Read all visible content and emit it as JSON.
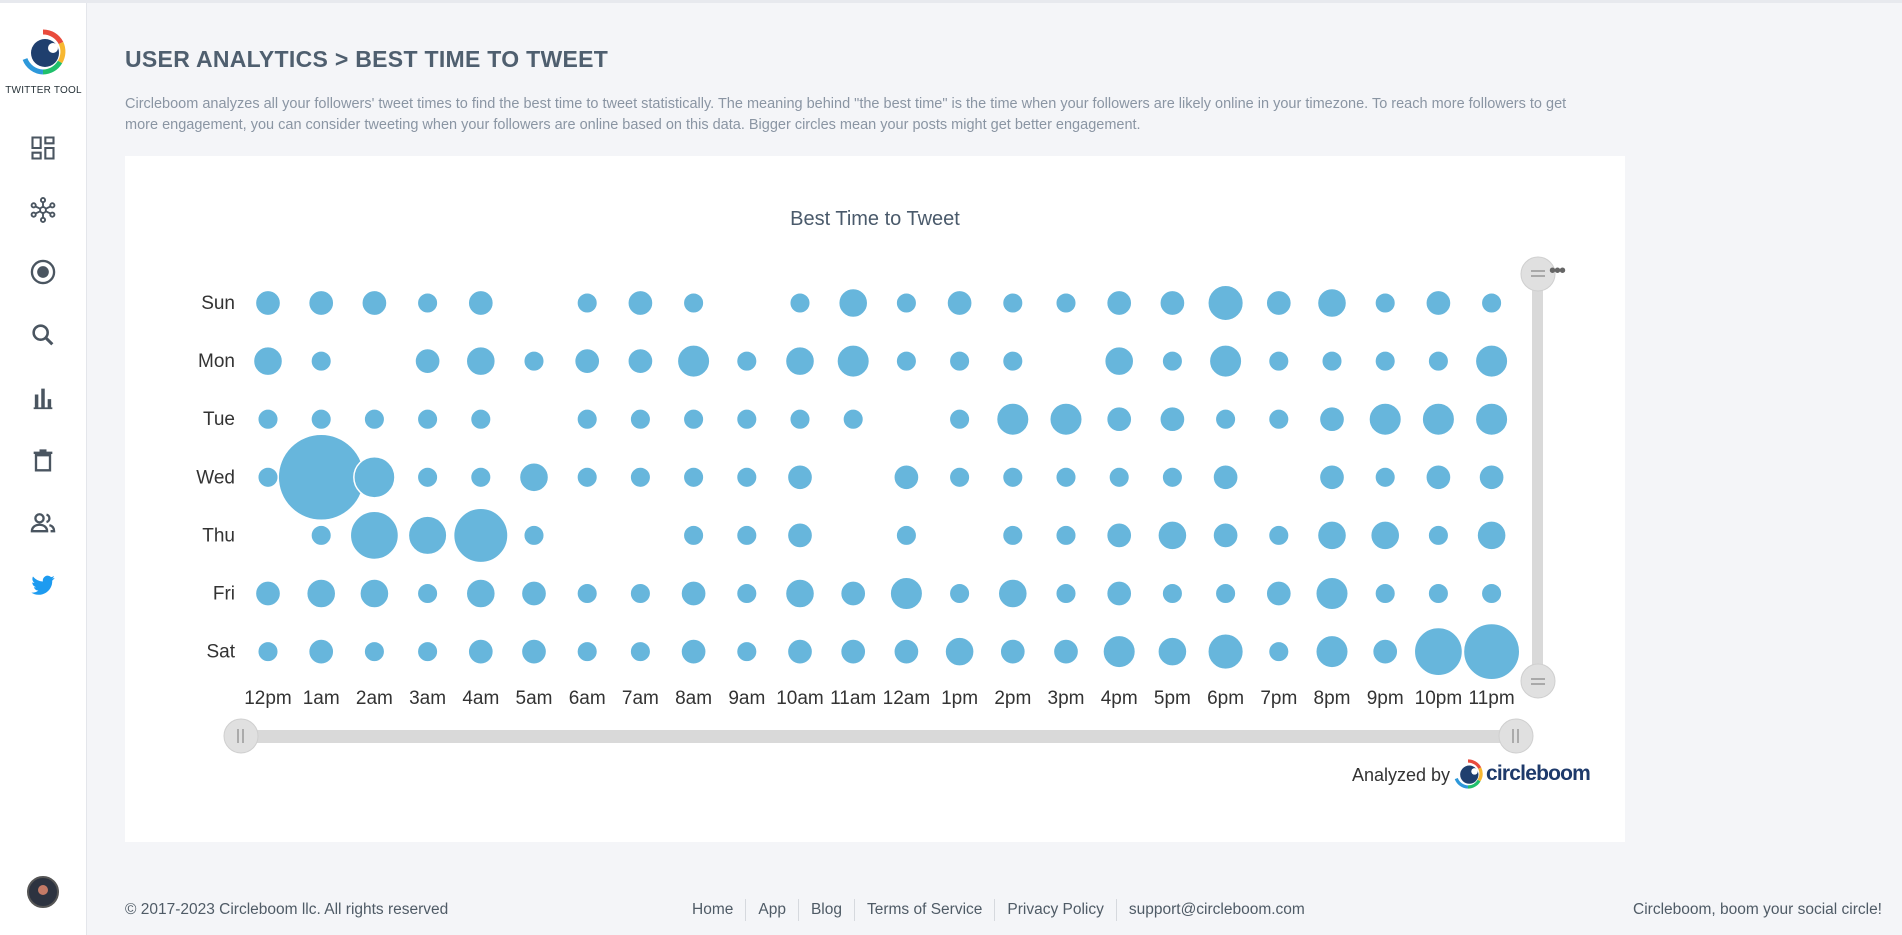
{
  "sidebar": {
    "logo_text": "TWITTER TOOL",
    "items": [
      {
        "name": "dashboard",
        "icon": "dashboard-icon"
      },
      {
        "name": "circle",
        "icon": "network-icon"
      },
      {
        "name": "target",
        "icon": "target-icon"
      },
      {
        "name": "search",
        "icon": "search-icon"
      },
      {
        "name": "analytics",
        "icon": "bar-chart-icon"
      },
      {
        "name": "delete",
        "icon": "trash-icon"
      },
      {
        "name": "users",
        "icon": "people-icon"
      },
      {
        "name": "twitter",
        "icon": "twitter-bird-icon"
      }
    ],
    "avatar": "avatar"
  },
  "header": {
    "title": "USER ANALYTICS > BEST TIME TO TWEET",
    "description": "Circleboom analyzes all your followers' tweet times to find the best time to tweet statistically. The meaning behind \"the best time\" is the time when your followers are likely online in your timezone. To reach more followers to get more engagement, you can consider tweeting when your followers are online based on this data. Bigger circles mean your posts might get better engagement."
  },
  "chart_data": {
    "type": "scatter",
    "title": "Best Time to Tweet",
    "x": [
      "12pm",
      "1am",
      "2am",
      "3am",
      "4am",
      "5am",
      "6am",
      "7am",
      "8am",
      "9am",
      "10am",
      "11am",
      "12am",
      "1pm",
      "2pm",
      "3pm",
      "4pm",
      "5pm",
      "6pm",
      "7pm",
      "8pm",
      "9pm",
      "10pm",
      "11pm"
    ],
    "y": [
      "Sun",
      "Mon",
      "Tue",
      "Wed",
      "Thu",
      "Fri",
      "Sat"
    ],
    "sizes": [
      [
        3,
        3,
        3,
        2,
        3,
        0,
        2,
        3,
        2,
        0,
        2,
        4,
        2,
        3,
        2,
        2,
        3,
        3,
        6,
        3,
        4,
        2,
        3,
        2
      ],
      [
        4,
        2,
        0,
        3,
        4,
        2,
        3,
        3,
        5,
        2,
        4,
        5,
        2,
        2,
        2,
        0,
        4,
        2,
        5,
        2,
        2,
        2,
        2,
        5
      ],
      [
        2,
        2,
        2,
        2,
        2,
        0,
        2,
        2,
        2,
        2,
        2,
        2,
        0,
        2,
        5,
        5,
        3,
        3,
        2,
        2,
        3,
        5,
        5,
        5
      ],
      [
        2,
        35,
        8,
        2,
        2,
        4,
        2,
        2,
        2,
        2,
        3,
        0,
        3,
        2,
        2,
        2,
        2,
        2,
        3,
        0,
        3,
        2,
        3,
        3
      ],
      [
        0,
        2,
        11,
        7,
        14,
        2,
        0,
        0,
        2,
        2,
        3,
        0,
        2,
        0,
        2,
        2,
        3,
        4,
        3,
        2,
        4,
        4,
        2,
        4
      ],
      [
        3,
        4,
        4,
        2,
        4,
        3,
        2,
        2,
        3,
        2,
        4,
        3,
        5,
        2,
        4,
        2,
        3,
        2,
        2,
        3,
        5,
        2,
        2,
        2
      ],
      [
        2,
        3,
        2,
        2,
        3,
        3,
        2,
        2,
        3,
        2,
        3,
        3,
        3,
        4,
        3,
        3,
        5,
        4,
        6,
        2,
        5,
        3,
        11,
        15
      ]
    ],
    "series": [
      {
        "name": "",
        "color": "#67b6dc"
      }
    ],
    "scroll_color": "#d9d9d9",
    "scroll_handle_color": "#e0e0e0",
    "legend": "none"
  },
  "card": {
    "analyzed_label": "Analyzed by",
    "brand": "circleboom",
    "menu": "•••"
  },
  "footer": {
    "copyright": "© 2017-2023 Circleboom llc. All rights reserved",
    "links": [
      "Home",
      "App",
      "Blog",
      "Terms of Service",
      "Privacy Policy",
      "support@circleboom.com"
    ],
    "tagline": "Circleboom, boom your social circle!"
  }
}
